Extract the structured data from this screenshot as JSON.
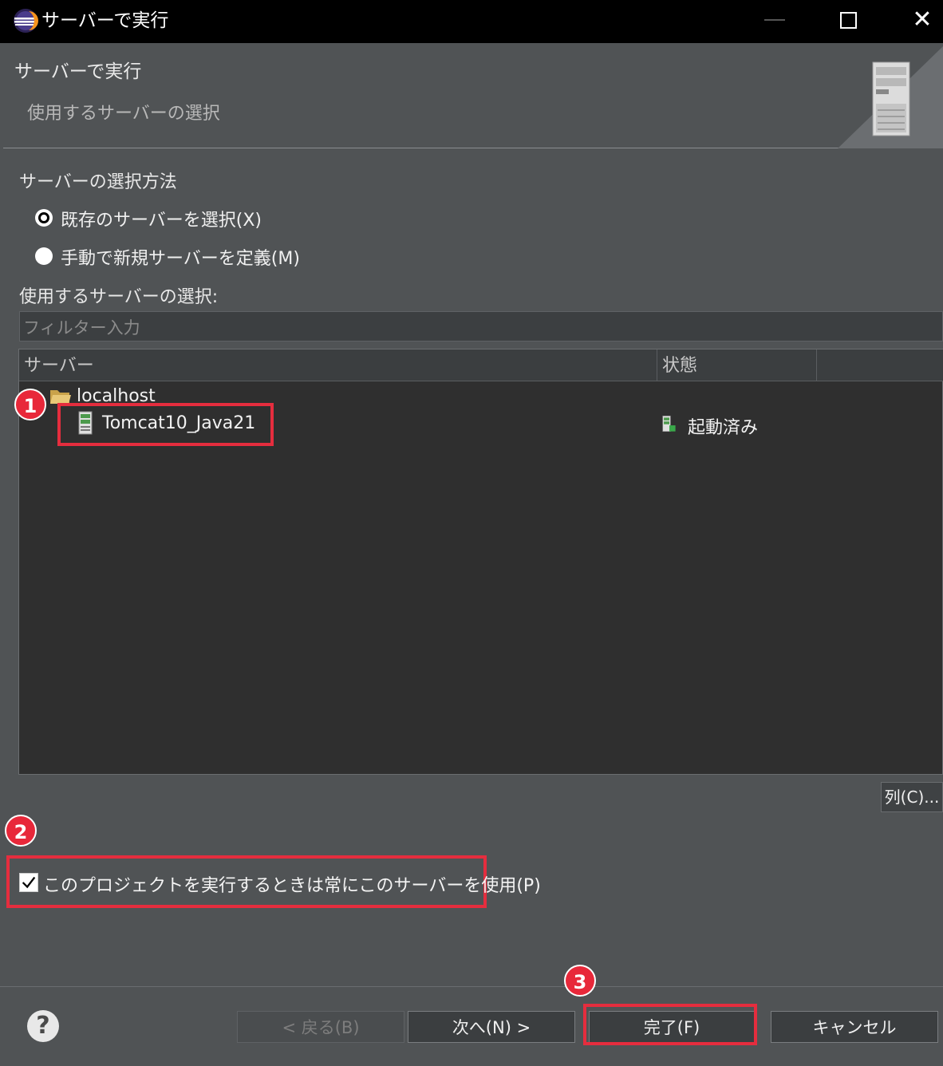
{
  "window": {
    "title": "サーバーで実行",
    "close_glyph": "✕"
  },
  "header": {
    "title": "サーバーで実行",
    "subtitle": "使用するサーバーの選択"
  },
  "selection_method": {
    "label": "サーバーの選択方法",
    "options": [
      {
        "label": "既存のサーバーを選択(X)",
        "selected": true
      },
      {
        "label": "手動で新規サーバーを定義(M)",
        "selected": false
      }
    ]
  },
  "server_select": {
    "label": "使用するサーバーの選択:",
    "filter_placeholder": "フィルター入力"
  },
  "table": {
    "columns": [
      "サーバー",
      "状態"
    ],
    "tree": {
      "host": "localhost",
      "servers": [
        {
          "name": "Tomcat10_Java21",
          "status": "起動済み"
        }
      ]
    }
  },
  "columns_button": "列(C)...",
  "always_use": {
    "label": "このプロジェクトを実行するときは常にこのサーバーを使用(P)",
    "checked": true
  },
  "callouts": [
    "1",
    "2",
    "3"
  ],
  "buttons": {
    "help": "?",
    "back": "< 戻る(B)",
    "next": "次へ(N) >",
    "finish": "完了(F)",
    "cancel": "キャンセル"
  },
  "colors": {
    "callout": "#e8283a",
    "highlight_box": "#e52d3e",
    "dialog_bg": "#505355",
    "table_bg": "#2f2f2f"
  }
}
